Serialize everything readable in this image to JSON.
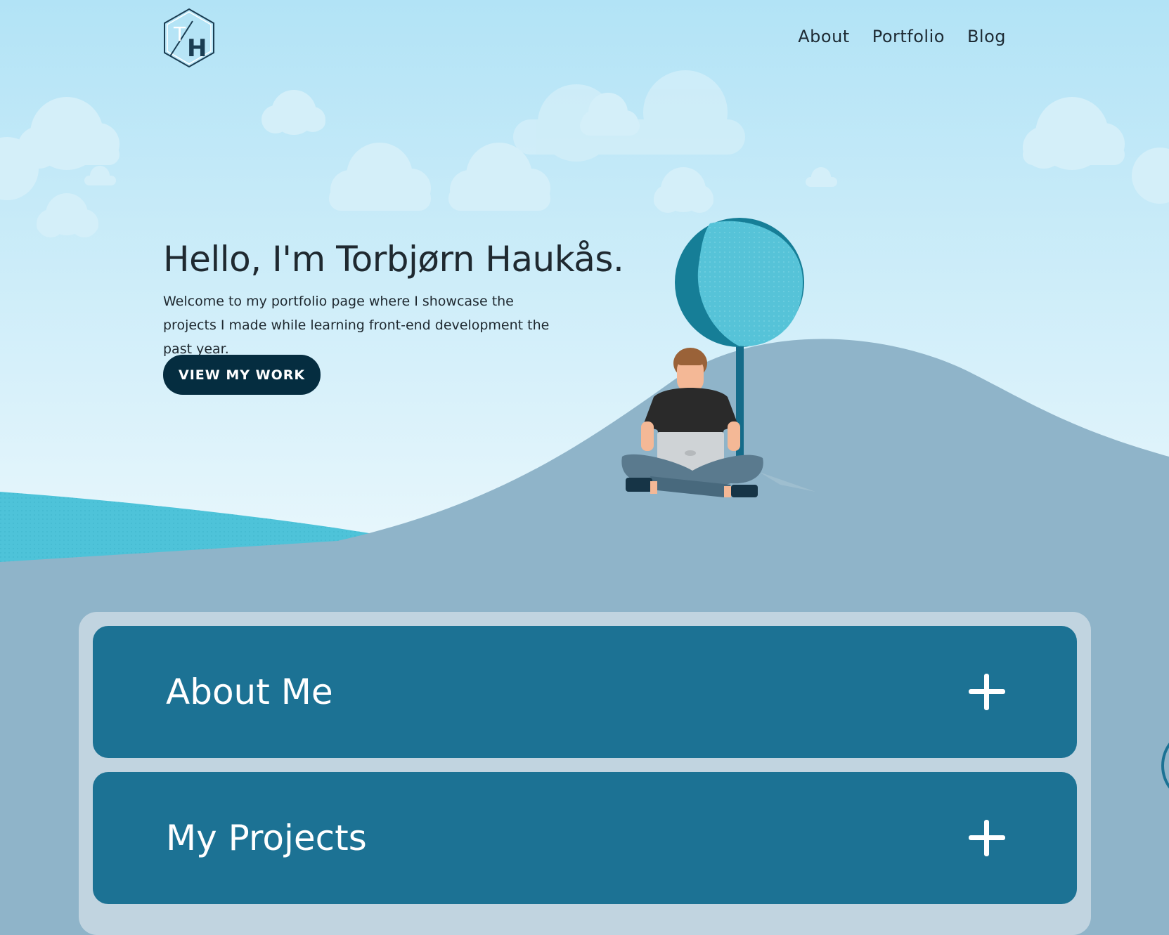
{
  "logo": {
    "letters": "TH"
  },
  "nav": {
    "items": [
      "About",
      "Portfolio",
      "Blog"
    ]
  },
  "hero": {
    "title": "Hello, I'm Torbjørn Haukås.",
    "subtitle": "Welcome to my portfolio page where I showcase the projects I made while learning front-end development the past year.",
    "cta_label": "VIEW MY WORK"
  },
  "panels": [
    {
      "title": "About Me"
    },
    {
      "title": "My Projects"
    }
  ],
  "colors": {
    "sky_top": "#b2e3f6",
    "sky_bottom": "#e6f6fc",
    "hill": "#8fb4c9",
    "water": "#4ec3d9",
    "panel": "#1c7294",
    "panel_frame": "#c1d4e0",
    "button": "#052d40",
    "tree_light": "#56c3d8",
    "tree_dark": "#167e97"
  }
}
